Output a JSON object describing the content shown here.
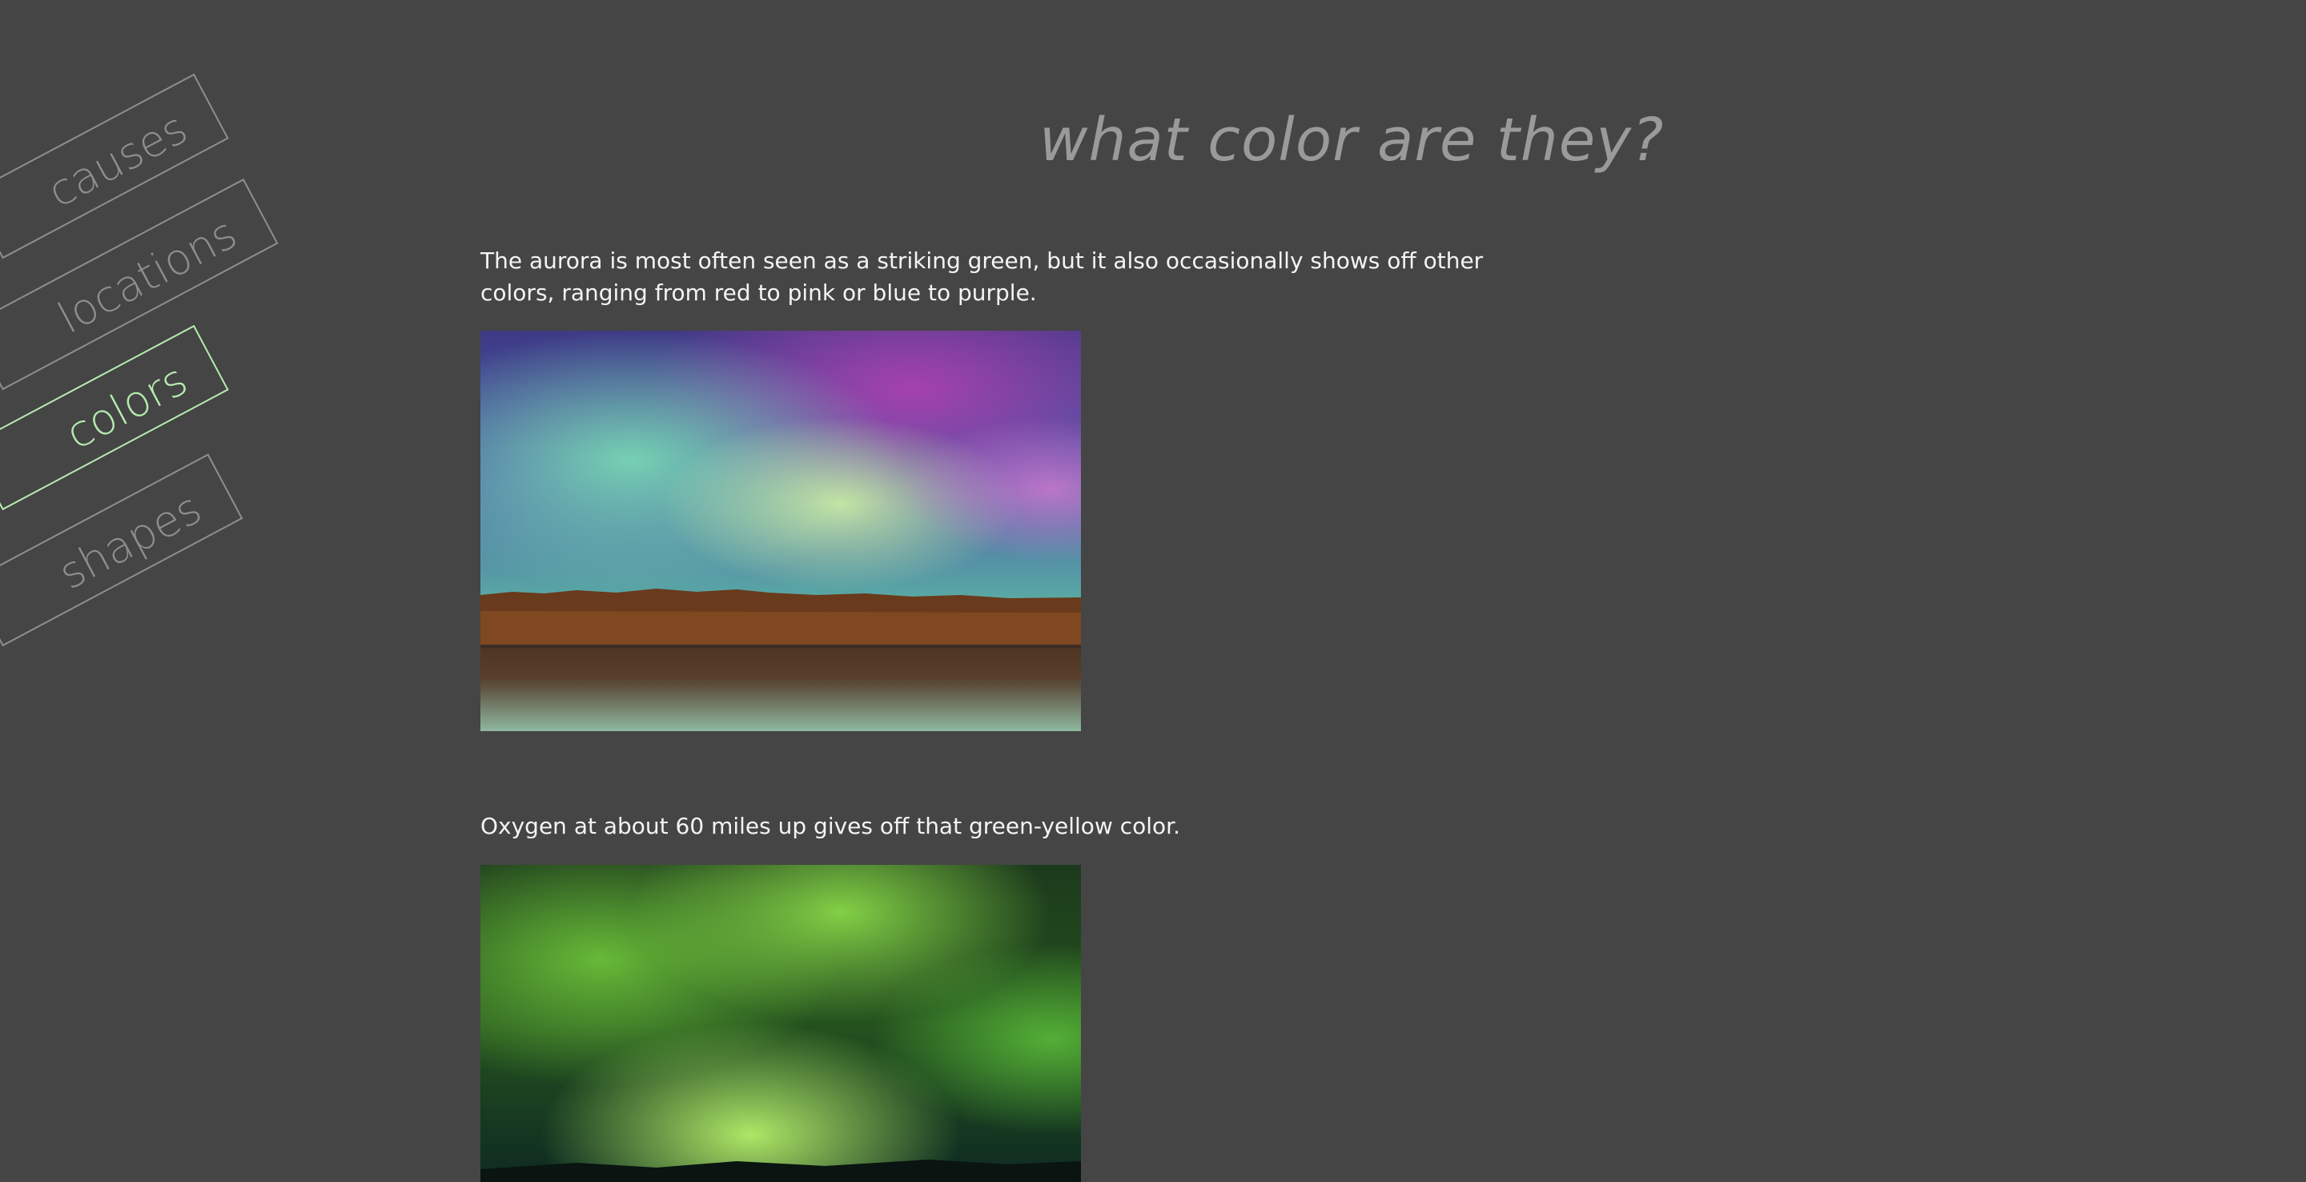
{
  "nav": {
    "items": [
      {
        "label": "causes",
        "active": false
      },
      {
        "label": "locations",
        "active": false
      },
      {
        "label": "colors",
        "active": true
      },
      {
        "label": "shapes",
        "active": false
      }
    ]
  },
  "main": {
    "title": "what color are they?",
    "paragraphs": [
      "The aurora is most often seen as a striking green, but it also occasionally shows off other colors, ranging from red to pink or blue to purple.",
      "Oxygen at about 60 miles up gives off that green-yellow color."
    ],
    "photos": [
      {
        "subject": "aurora-multicolor-over-lake"
      },
      {
        "subject": "green-aurora"
      }
    ]
  },
  "colors": {
    "background": "#454545",
    "nav_inactive": "#8e8e8e",
    "nav_active": "#b6ecb0",
    "title": "#9a9a9a",
    "body_text": "#f4f4f4"
  }
}
